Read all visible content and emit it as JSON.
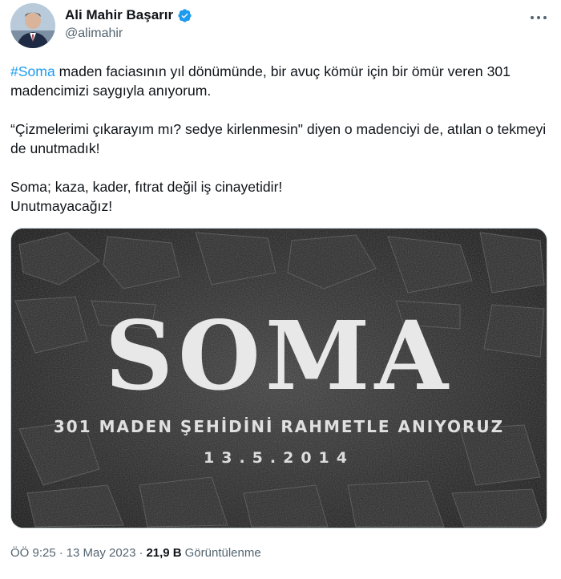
{
  "author": {
    "name": "Ali Mahir Başarır",
    "handle": "@alimahir"
  },
  "tweet": {
    "hashtag": "#Soma",
    "line1_rest": " maden faciasının yıl dönümünde, bir avuç kömür için bir ömür veren 301 madencimizi saygıyla anıyorum.",
    "para2": "“Çizmelerimi çıkarayım mı? sedye kirlenmesin\" diyen o madenciyi de, atılan o tekmeyi de unutmadık!",
    "para3_line1": "Soma; kaza, kader, fıtrat değil iş cinayetidir!",
    "para3_line2": "Unutmayacağız!"
  },
  "media": {
    "headline": "SOMA",
    "subtitle": "301 MADEN ŞEHİDİNİ RAHMETLE ANIYORUZ",
    "date": "13.5.2014"
  },
  "meta": {
    "time": "ÖÖ 9:25",
    "sep1": "·",
    "date": "13 May 2023",
    "sep2": "·",
    "views_count": "21,9 B",
    "views_label": "Görüntülenme"
  },
  "icons": {
    "verified": "verified-badge-icon",
    "more": "more-dots-icon"
  },
  "colors": {
    "accent": "#1d9bf0",
    "secondary_text": "#536471"
  }
}
